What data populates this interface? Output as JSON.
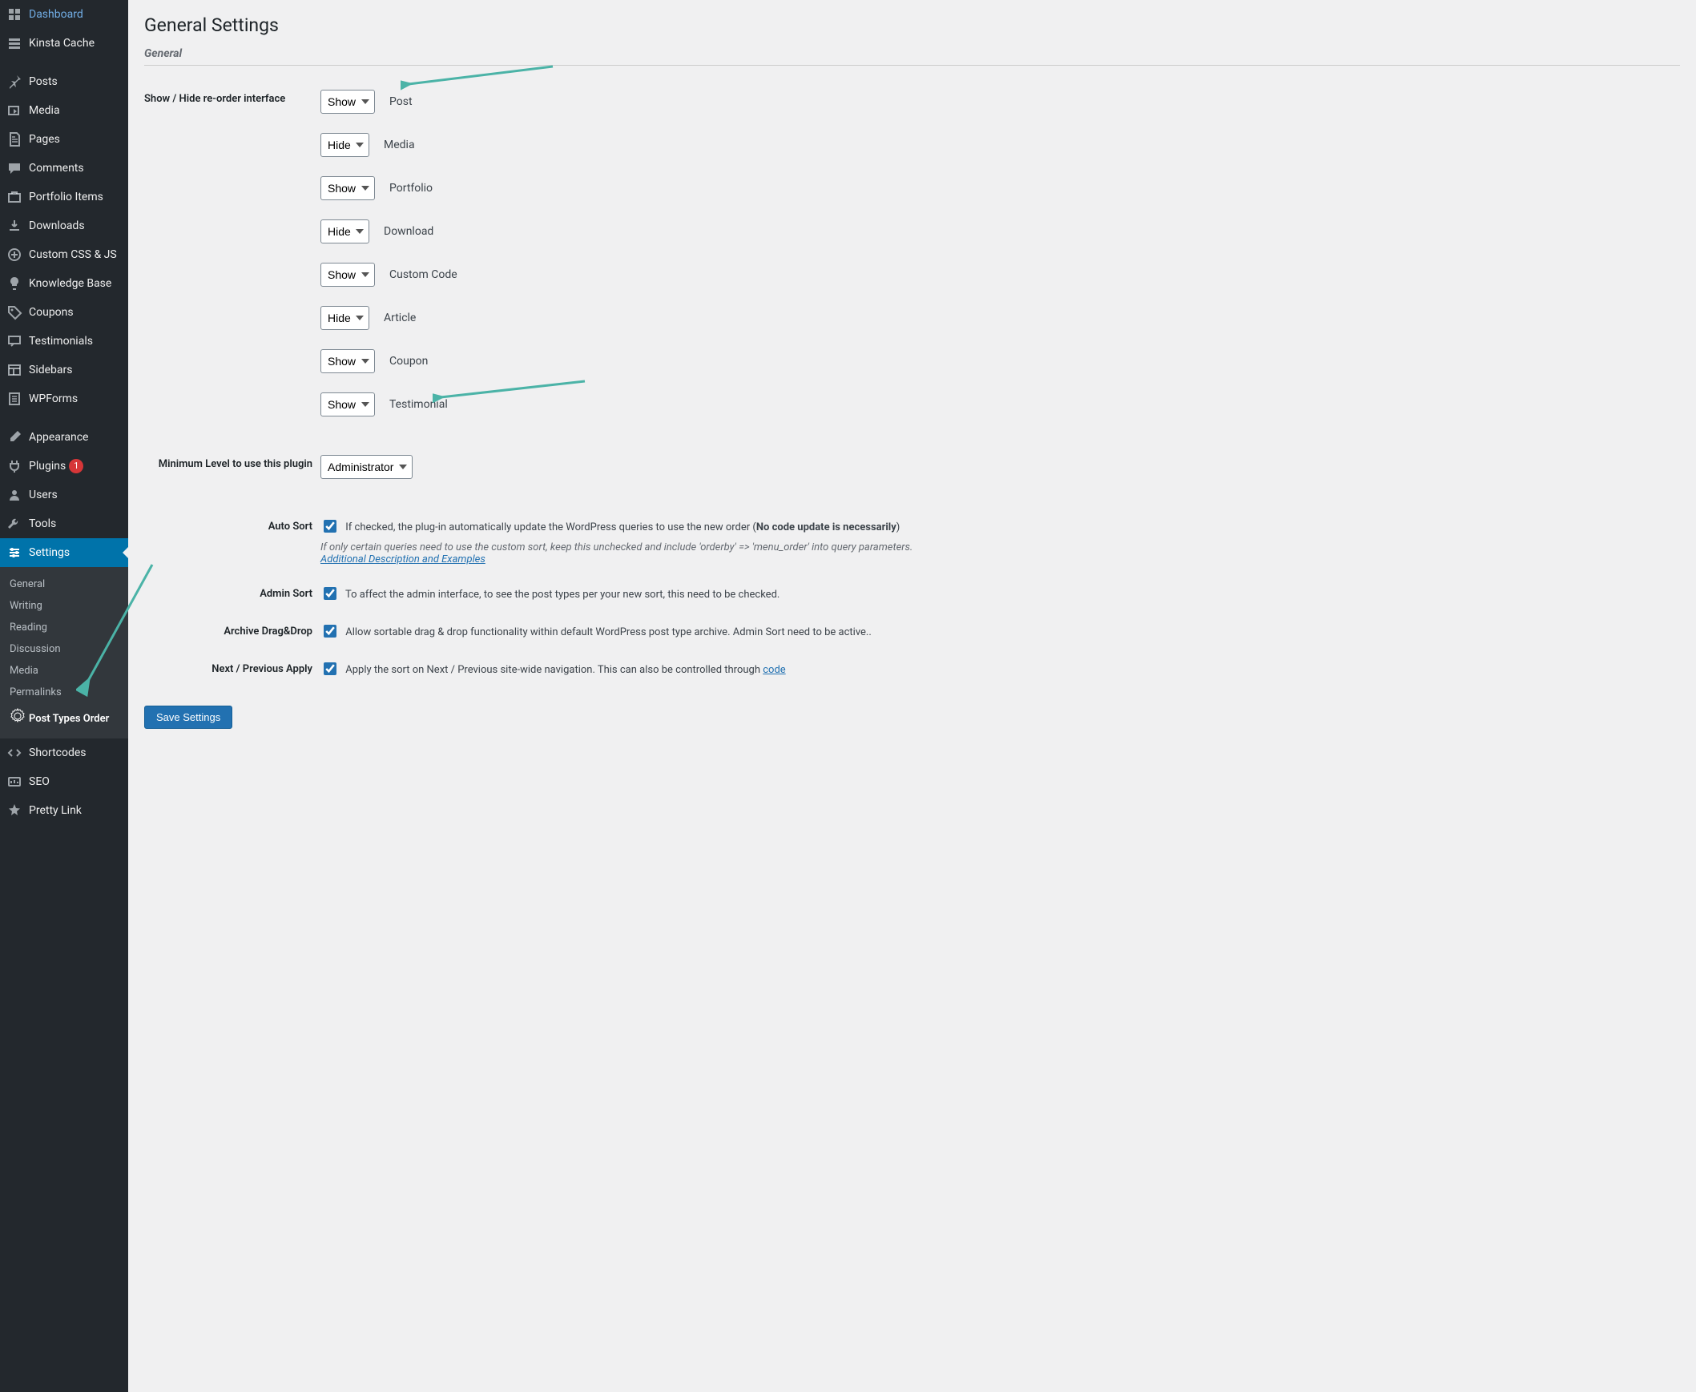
{
  "sidebar_top": [
    {
      "id": "dashboard",
      "label": "Dashboard",
      "icon": "dashboard"
    },
    {
      "id": "kinsta",
      "label": "Kinsta Cache",
      "icon": "kinsta"
    }
  ],
  "sidebar_main": [
    {
      "id": "posts",
      "label": "Posts",
      "icon": "pin"
    },
    {
      "id": "media",
      "label": "Media",
      "icon": "media"
    },
    {
      "id": "pages",
      "label": "Pages",
      "icon": "pages"
    },
    {
      "id": "comments",
      "label": "Comments",
      "icon": "comment"
    },
    {
      "id": "portfolio",
      "label": "Portfolio Items",
      "icon": "portfolio"
    },
    {
      "id": "downloads",
      "label": "Downloads",
      "icon": "download"
    },
    {
      "id": "custom-css",
      "label": "Custom CSS & JS",
      "icon": "plus-circle"
    },
    {
      "id": "knowledge",
      "label": "Knowledge Base",
      "icon": "lightbulb"
    },
    {
      "id": "coupons",
      "label": "Coupons",
      "icon": "tag"
    },
    {
      "id": "testimonials",
      "label": "Testimonials",
      "icon": "testimonial"
    },
    {
      "id": "sidebars",
      "label": "Sidebars",
      "icon": "layout"
    },
    {
      "id": "wpforms",
      "label": "WPForms",
      "icon": "wpforms"
    }
  ],
  "sidebar_bottom": [
    {
      "id": "appearance",
      "label": "Appearance",
      "icon": "brush"
    },
    {
      "id": "plugins",
      "label": "Plugins",
      "icon": "plug",
      "badge": "1"
    },
    {
      "id": "users",
      "label": "Users",
      "icon": "user"
    },
    {
      "id": "tools",
      "label": "Tools",
      "icon": "wrench"
    },
    {
      "id": "settings",
      "label": "Settings",
      "icon": "sliders",
      "current": true
    }
  ],
  "settings_submenu": [
    {
      "label": "General"
    },
    {
      "label": "Writing"
    },
    {
      "label": "Reading"
    },
    {
      "label": "Discussion"
    },
    {
      "label": "Media"
    },
    {
      "label": "Permalinks"
    },
    {
      "label": "Post Types Order",
      "current": true,
      "icon": true
    }
  ],
  "sidebar_after": [
    {
      "id": "shortcodes",
      "label": "Shortcodes",
      "icon": "code"
    },
    {
      "id": "seo",
      "label": "SEO",
      "icon": "seo"
    },
    {
      "id": "prettylink",
      "label": "Pretty Link",
      "icon": "star"
    }
  ],
  "page": {
    "title": "General Settings",
    "section": "General",
    "labels": {
      "show_hide": "Show / Hide re-order interface",
      "min_level": "Minimum Level to use this plugin",
      "auto_sort": "Auto Sort",
      "admin_sort": "Admin Sort",
      "archive": "Archive Drag&Drop",
      "next_prev": "Next / Previous Apply"
    },
    "post_types": [
      {
        "label": "Post",
        "value": "Show"
      },
      {
        "label": "Media",
        "value": "Hide"
      },
      {
        "label": "Portfolio",
        "value": "Show"
      },
      {
        "label": "Download",
        "value": "Hide"
      },
      {
        "label": "Custom Code",
        "value": "Show"
      },
      {
        "label": "Article",
        "value": "Hide"
      },
      {
        "label": "Coupon",
        "value": "Show"
      },
      {
        "label": "Testimonial",
        "value": "Show"
      }
    ],
    "min_level_value": "Administrator",
    "auto_sort": {
      "text_pre": "If checked, the plug-in automatically update the WordPress queries to use the new order (",
      "bold": "No code update is necessarily",
      "text_post": ")",
      "desc": "If only certain queries need to use the custom sort, keep this unchecked and include 'orderby' => 'menu_order' into query parameters.",
      "link": "Additional Description and Examples"
    },
    "admin_sort_text": "To affect the admin interface, to see the post types per your new sort, this need to be checked.",
    "archive_text": "Allow sortable drag & drop functionality within default WordPress post type archive. Admin Sort need to be active..",
    "next_prev": {
      "text": "Apply the sort on Next / Previous site-wide navigation. This can also be controlled through ",
      "link": "code"
    },
    "save_button": "Save Settings"
  },
  "colors": {
    "arrow": "#4bb3a7"
  }
}
